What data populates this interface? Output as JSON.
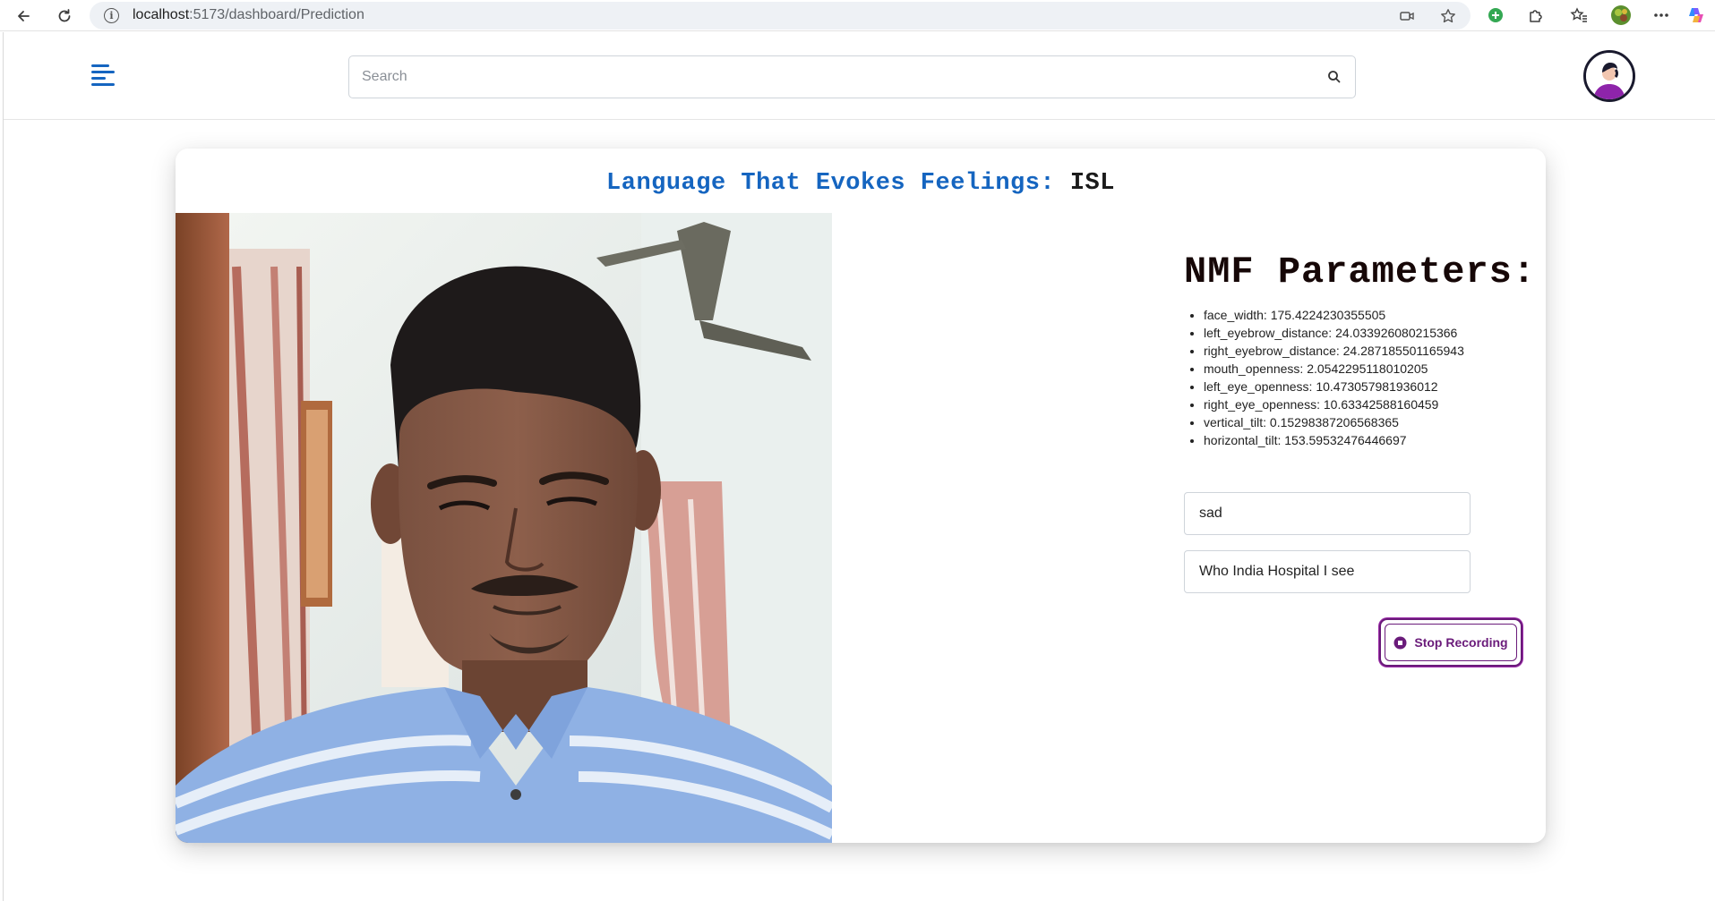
{
  "browser": {
    "url_host": "localhost",
    "url_rest": ":5173/dashboard/Prediction"
  },
  "header": {
    "search_placeholder": "Search"
  },
  "main": {
    "title_main": "Language That Evokes Feelings:",
    "title_accent": "ISL",
    "nmf_title": "NMF Parameters:",
    "parameters": [
      "face_width: 175.4224230355505",
      "left_eyebrow_distance: 24.033926080215366",
      "right_eyebrow_distance: 24.287185501165943",
      "mouth_openness: 2.0542295118010205",
      "left_eye_openness: 10.473057981936012",
      "right_eye_openness: 10.63342588160459",
      "vertical_tilt: 0.15298387206568365",
      "horizontal_tilt: 153.59532476446697"
    ],
    "emotion_value": "sad",
    "sentence_value": "Who India Hospital I see",
    "stop_label": "Stop Recording"
  },
  "colors": {
    "accent_blue": "#1565c0",
    "stop_purple": "#6a1b7a"
  }
}
